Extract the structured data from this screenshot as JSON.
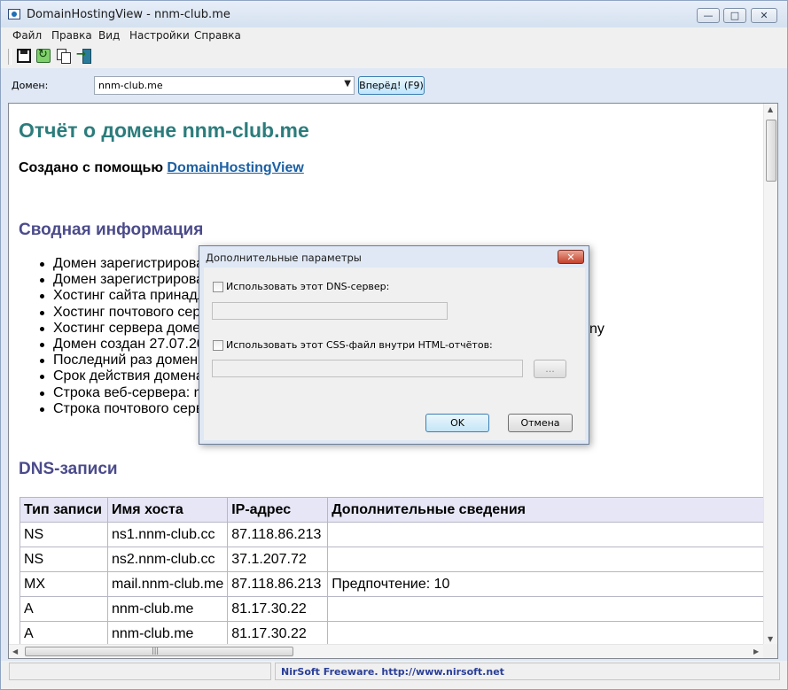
{
  "window": {
    "title": "DomainHostingView  -  nnm-club.me",
    "minimize_glyph": "—",
    "maximize_glyph": "□",
    "close_glyph": "✕"
  },
  "menu": [
    "Файл",
    "Правка",
    "Вид",
    "Настройки",
    "Справка"
  ],
  "toolbar": {
    "icons": [
      "save-icon",
      "refresh-icon",
      "copy-icon",
      "exit-icon"
    ]
  },
  "domain_row": {
    "label": "Домен:",
    "value": "nnm-club.me",
    "go_label": "Вперёд! (F9)"
  },
  "report": {
    "title": "Отчёт о домене nnm-club.me",
    "created_prefix": "Создано с помощью ",
    "created_link": "DomainHostingView",
    "summary_heading": "Сводная информация",
    "summary_items": [
      "Домен зарегистрирова",
      "Домен зарегистрирова",
      "Хостинг сайта принадл",
      "Хостинг почтового серв",
      "Хостинг сервера доме",
      "Домен создан 27.07.20",
      "Последний раз домен о",
      "Срок действия домена",
      "Строка веб-сервера: n",
      "Строка почтового серв"
    ],
    "summary_item_5_tail": "ny",
    "dns_heading": "DNS-записи",
    "dns_columns": [
      "Тип записи",
      "Имя хоста",
      "IP-адрес",
      "Дополнительные сведения"
    ],
    "dns_rows": [
      [
        "NS",
        "ns1.nnm-club.cc",
        "87.118.86.213",
        ""
      ],
      [
        "NS",
        "ns2.nnm-club.cc",
        "37.1.207.72",
        ""
      ],
      [
        "MX",
        "mail.nnm-club.me",
        "87.118.86.213",
        "Предпочтение: 10"
      ],
      [
        "A",
        "nnm-club.me",
        "81.17.30.22",
        ""
      ],
      [
        "A",
        "nnm-club.me",
        "81.17.30.22",
        ""
      ]
    ]
  },
  "scroll": {
    "up": "▲",
    "down": "▼",
    "left": "◀",
    "right": "▶",
    "grip": "|||"
  },
  "status": {
    "text": "NirSoft Freeware.  http://www.nirsoft.net"
  },
  "dialog": {
    "title": "Дополнительные параметры",
    "close_glyph": "✕",
    "dns_checkbox_label": "Использовать этот DNS-сервер:",
    "dns_value": "",
    "css_checkbox_label": "Использовать этот CSS-файл внутри HTML-отчётов:",
    "css_value": "",
    "browse_label": "...",
    "ok_label": "OK",
    "cancel_label": "Отмена"
  },
  "colors": {
    "report_title": "#2c7c7c",
    "section_heading": "#4b4b8b",
    "link": "#1b5fa3",
    "status_text": "#2a3f99",
    "table_header_bg": "#e6e6f6"
  }
}
